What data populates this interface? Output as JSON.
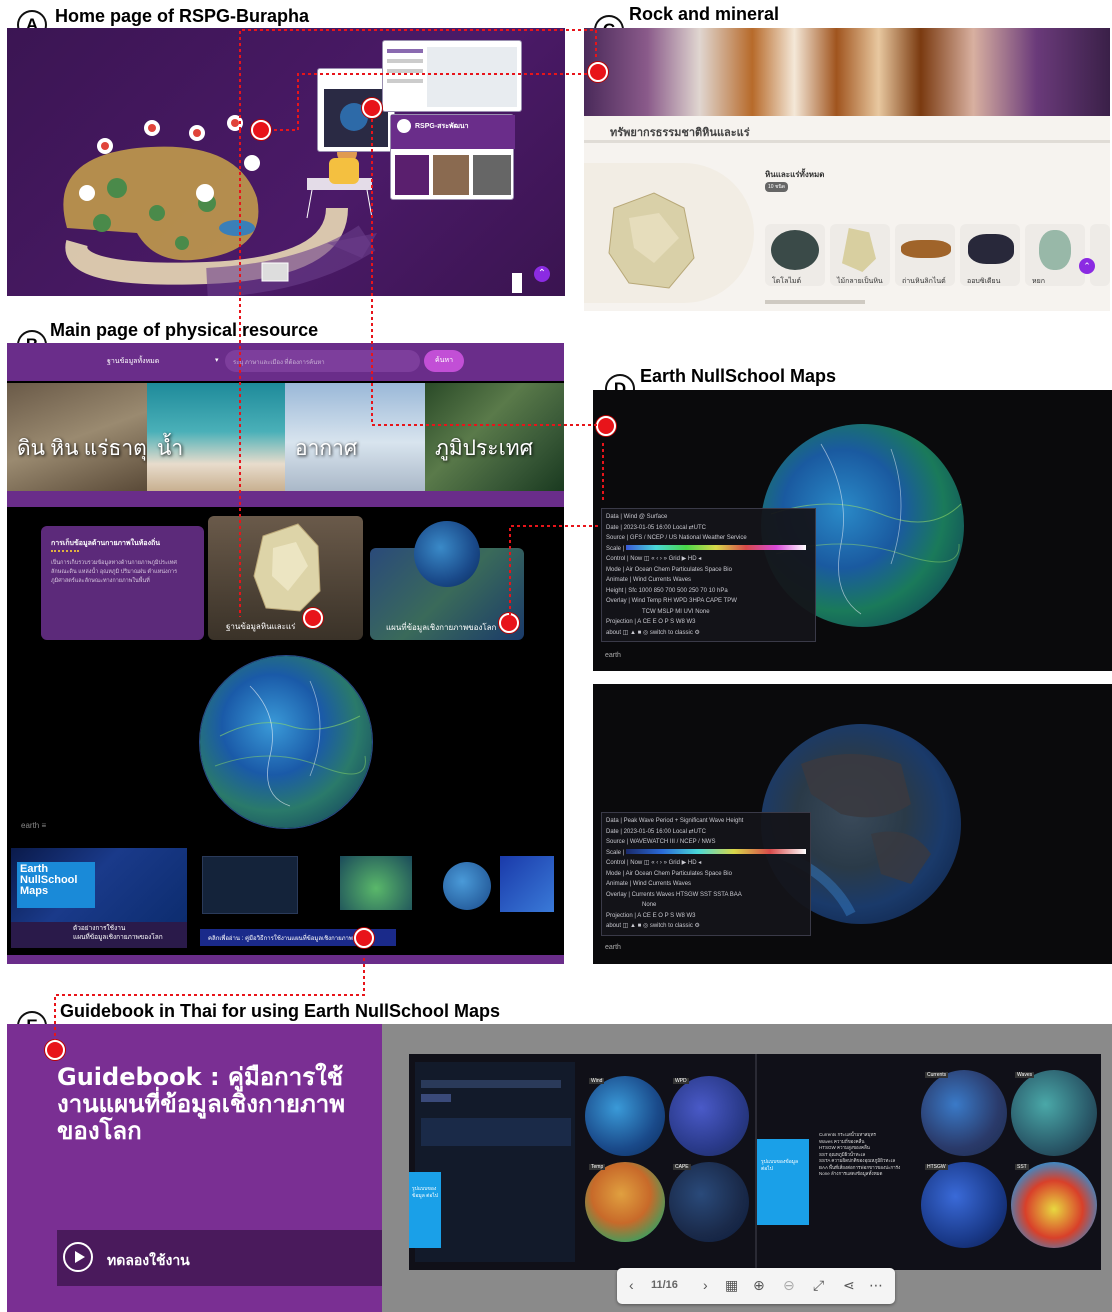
{
  "panels": {
    "a": {
      "letter": "A",
      "title": "Home page of RSPG-Burapha"
    },
    "b": {
      "letter": "B",
      "title": "Main page of physical resource"
    },
    "c": {
      "letter": "C",
      "title": "Rock and mineral"
    },
    "d": {
      "letter": "D",
      "title": "Earth NullSchool Maps"
    },
    "e": {
      "letter": "E",
      "title": "Guidebook in Thai for using Earth NullSchool Maps"
    }
  },
  "home": {
    "card_label": "RSPG-สระพัฒนา"
  },
  "physical": {
    "dropdown": "ฐานข้อมูลทั้งหมด",
    "search_placeholder": "ระบุ ภาษาและเมือง ที่ต้องการค้นหา",
    "search_button": "ค้นหา",
    "tiles": [
      "ดิน หิน แร่ธาตุ",
      "น้ำ",
      "อากาศ",
      "ภูมิประเทศ"
    ],
    "info_title": "การเก็บข้อมูลด้านกายภาพในท้องถิ่น",
    "info_body": "เป็นการเก็บรวบรวมข้อมูลทางด้านกายภาพภูมิประเทศ ลักษณะดิน แหล่งน้ำ อุณหภูมิ ปริมาณฝน ตำแหน่งการ ภูมิศาสตร์และลักษณะทางกายภาพในพื้นที่",
    "card_rock": "ฐานข้อมูลหินและแร่",
    "card_map": "แผนที่ข้อมูลเชิงกายภาพของโลก",
    "earth_label": "earth ≡",
    "enm_logo": "Earth\nNullSchool\nMaps",
    "enm_caption": "ตัวอย่างการใช้งาน\nแผนที่ข้อมูลเชิงกายภาพของโลก",
    "guide_link": "คลิกเพื่ออ่าน : คู่มือวิธีการใช้งานแผนที่ข้อมูลเชิงกายภาพของโลก"
  },
  "rock": {
    "heading": "ทรัพยากรธรรมชาติหินและแร่",
    "section": "หินและแร่ทั้งหมด",
    "badge": "10 ชนิด",
    "items": [
      "โดโลไมต์",
      "ไม้กลายเป็นหิน",
      "ถ่านหินลิกไนต์",
      "ออบซิเดียน",
      "หยก"
    ]
  },
  "earth1": {
    "rows": [
      "Data | Wind @ Surface",
      "Date | 2023-01-05 16:00 Local ⇄UTC",
      "Source | GFS / NCEP / US National Weather Service",
      "Scale |",
      "Control | Now ◫  «  ‹  ›  »  Grid ▶ HD ◂",
      "Mode | Air  Ocean  Chem  Particulates  Space  Bio",
      "Animate | Wind  Currents  Waves",
      "Height | Sfc  1000  850  700  500  250  70  10  hPa",
      "Overlay | Wind  Temp  RH  WPD  3HPA  CAPE  TPW",
      "TCW  MSLP  MI  UVI  None",
      "Projection | A  CE  E  O  P  S  W8  W3",
      "about  ◫  ▲  ■  ◎    switch to classic  ⚙"
    ],
    "label": "earth"
  },
  "earth2": {
    "rows": [
      "Data | Peak Wave Period + Significant Wave Height",
      "Date | 2023-01-05 16:00 Local ⇄UTC",
      "Source | WAVEWATCH III / NCEP / NWS",
      "Scale |",
      "Control | Now ◫  «  ‹  ›  »  Grid ▶ HD ◂",
      "Mode | Air  Ocean  Chem  Particulates  Space  Bio",
      "Animate | Wind  Currents  Waves",
      "Overlay | Currents  Waves  HTSGW  SST  SSTA  BAA",
      "None",
      "Projection | A  CE  E  O  P  S  W8  W3",
      "about  ◫  ▲  ■  ◎    switch to classic  ⚙"
    ],
    "label": "earth"
  },
  "guide": {
    "title": "Guidebook : คู่มือการใช้งานแผนที่ข้อมูลเชิงกายภาพของโลก",
    "play_label": "ทดลองใช้งาน",
    "page": "11/16",
    "left_tag": "รูปแบบของข้อมูล ต่อไป",
    "right_tag": "รูปแบบของข้อมูล ต่อไป",
    "globe_labels": [
      "Wind",
      "WPD",
      "Temp",
      "CAPE",
      "Currents",
      "Waves",
      "HTSGW",
      "SST"
    ],
    "bullets": [
      "Currents กระแสน้ำมหาสมุทร",
      "Waves ความถี่ของคลื่น",
      "HTSGW ความสูงของคลื่น",
      "SST อุณหภูมิผิวน้ำทะเล",
      "SSTA ความผิดปกติของอุณหภูมิผิวทะเล",
      "BAA พื้นที่เสี่ยงต่อการฟอกขาวของปะการัง",
      "None ล้างการแสดงข้อมูลทั้งหมด"
    ]
  }
}
